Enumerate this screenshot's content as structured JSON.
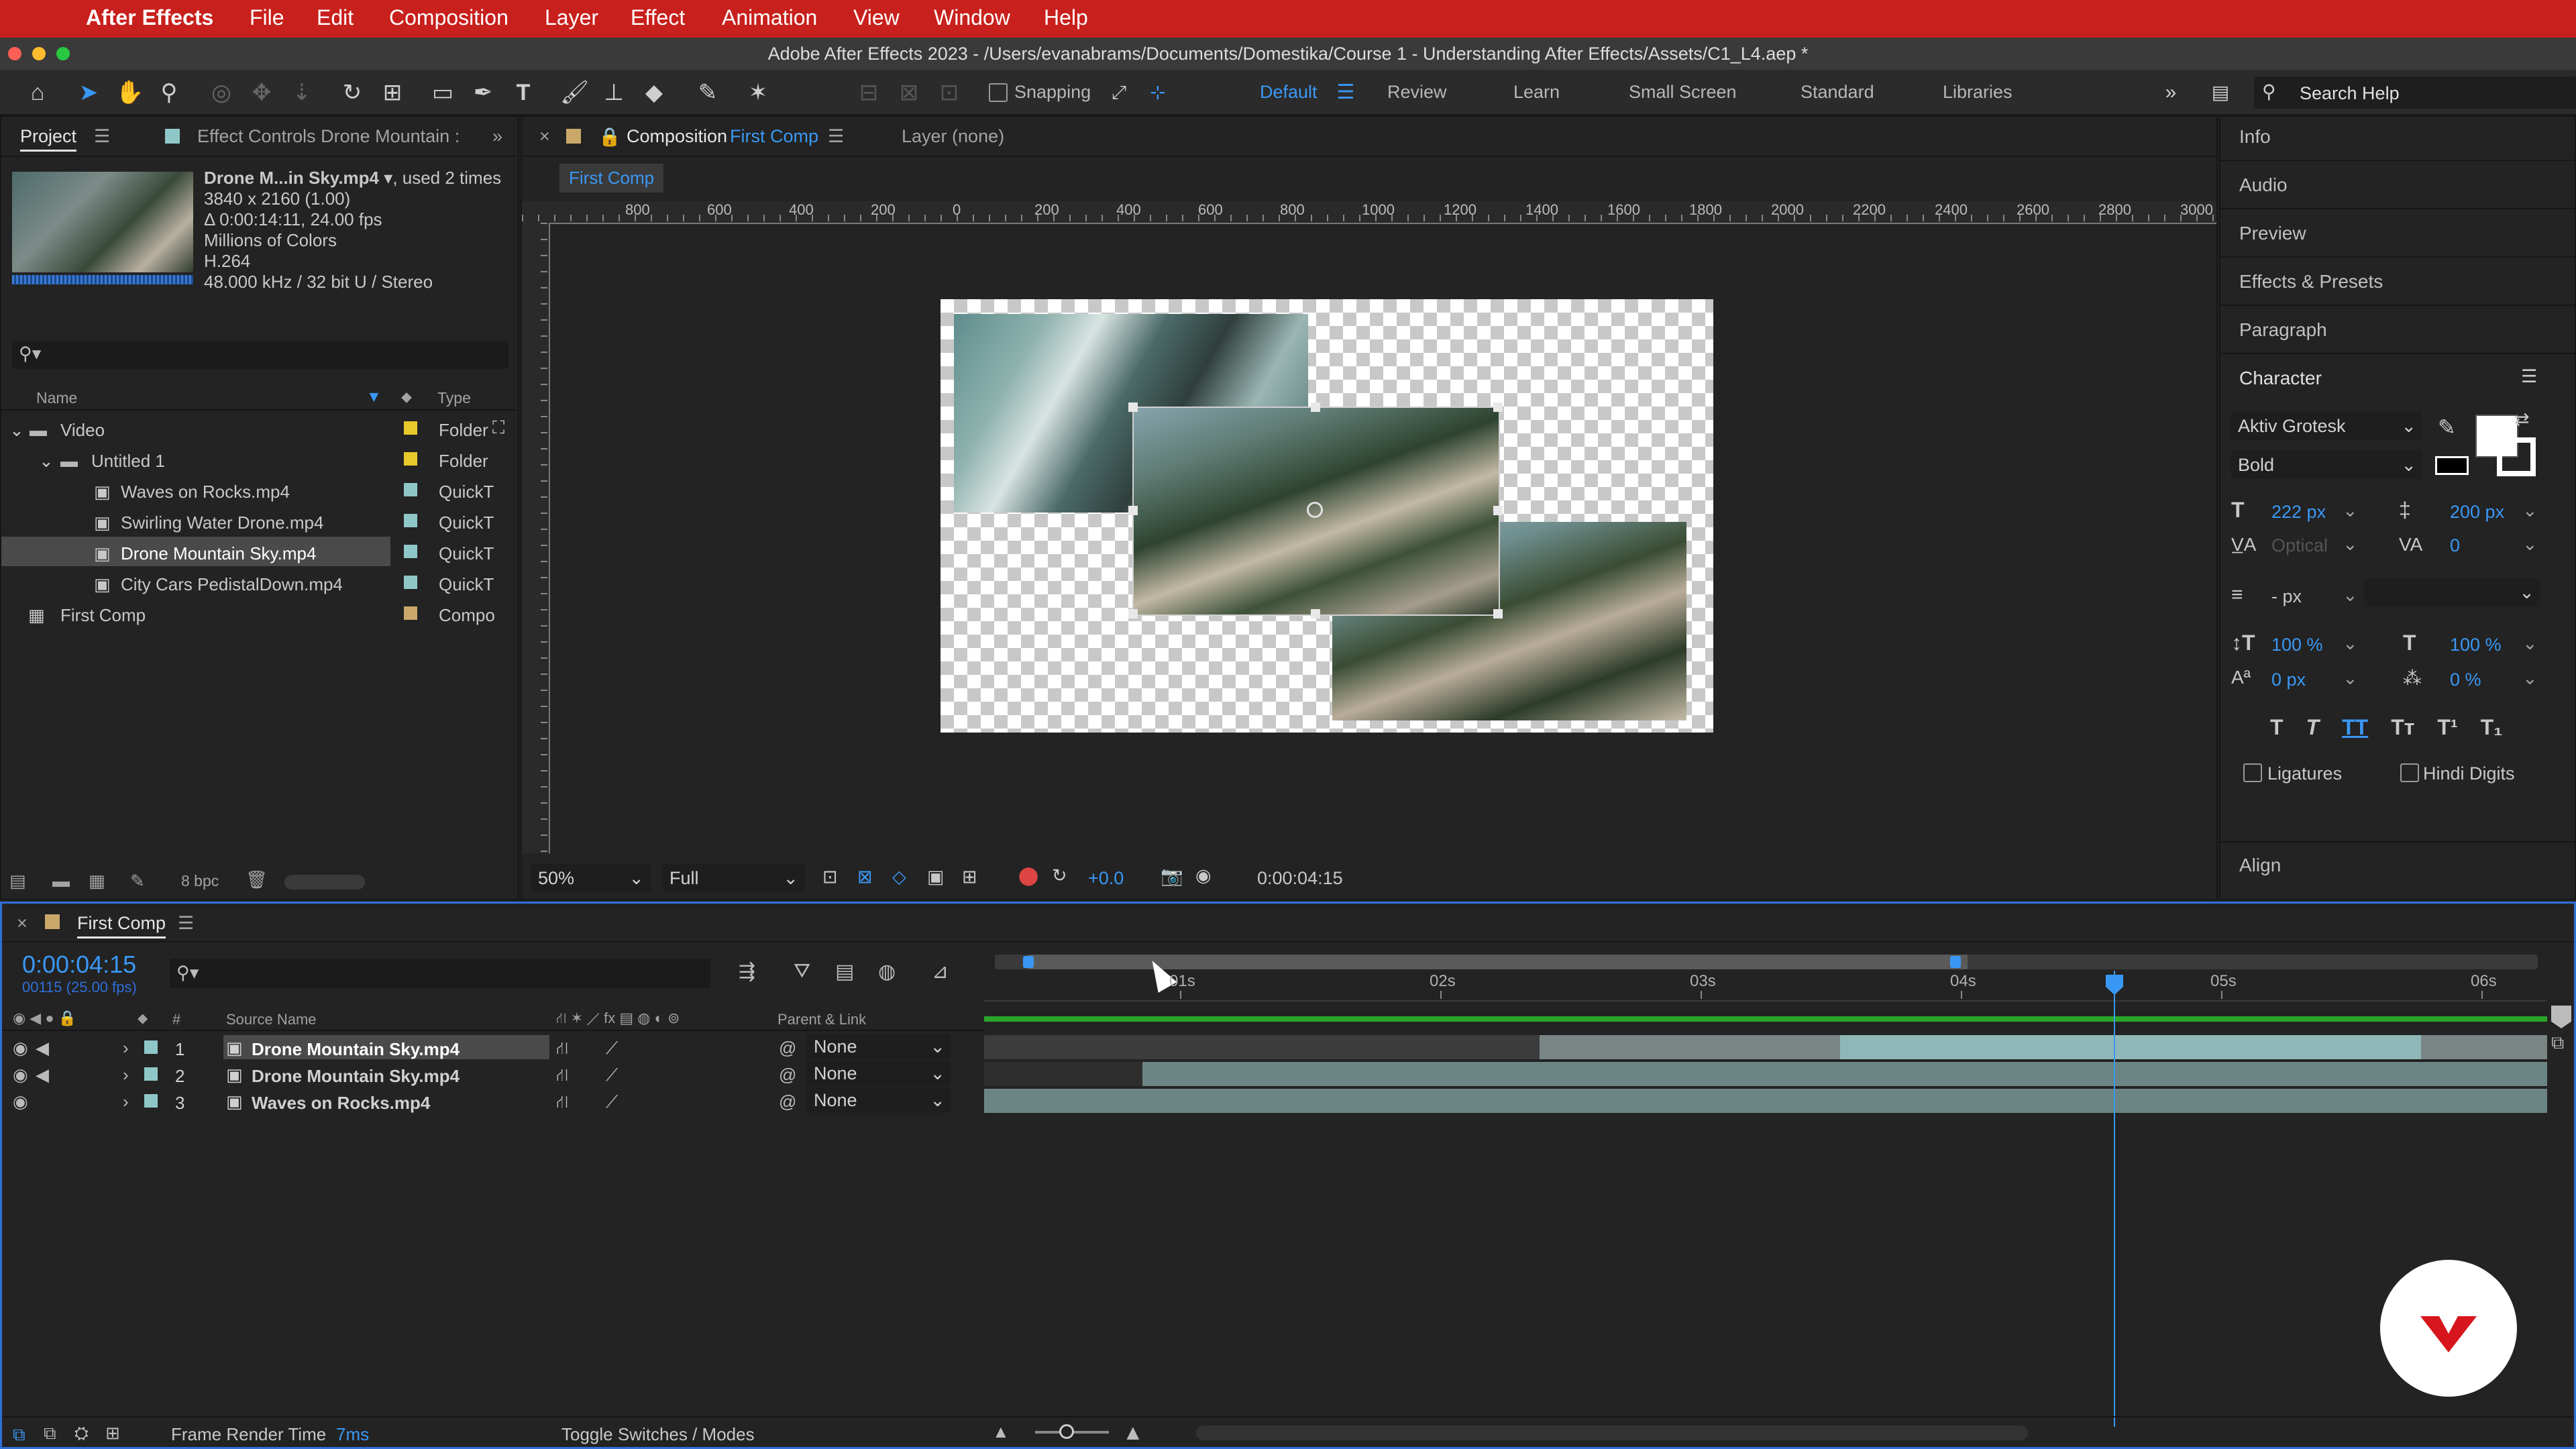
{
  "menubar": {
    "app": "After Effects",
    "items": [
      "File",
      "Edit",
      "Composition",
      "Layer",
      "Effect",
      "Animation",
      "View",
      "Window",
      "Help"
    ]
  },
  "window_title": "Adobe After Effects 2023 - /Users/evanabrams/Documents/Domestika/Course 1 - Understanding After Effects/Assets/C1_L4.aep *",
  "toolbar": {
    "snapping_label": "Snapping",
    "workspaces": [
      "Default",
      "Review",
      "Learn",
      "Small Screen",
      "Standard",
      "Libraries"
    ],
    "active_workspace": "Default",
    "search_placeholder": "Search Help"
  },
  "project_panel": {
    "tab_project": "Project",
    "tab_effect_controls": "Effect Controls Drone Mountain :",
    "selected_item": {
      "name": "Drone M...in Sky.mp4",
      "used": ", used 2 times",
      "resolution": "3840 x 2160 (1.00)",
      "duration": "Δ 0:00:14:11, 24.00 fps",
      "colors": "Millions of Colors",
      "codec": "H.264",
      "audio": "48.000 kHz / 32 bit U / Stereo"
    },
    "columns": {
      "name": "Name",
      "type": "Type"
    },
    "items": [
      {
        "name": "Video",
        "type": "Folder",
        "color": "#e8c92c"
      },
      {
        "name": "Untitled 1",
        "type": "Folder",
        "color": "#e8c92c"
      },
      {
        "name": "Waves on Rocks.mp4",
        "type": "QuickT",
        "color": "#8fc7c8"
      },
      {
        "name": "Swirling Water Drone.mp4",
        "type": "QuickT",
        "color": "#8fc7c8"
      },
      {
        "name": "Drone Mountain Sky.mp4",
        "type": "QuickT",
        "color": "#8fc7c8"
      },
      {
        "name": "City Cars PedistalDown.mp4",
        "type": "QuickT",
        "color": "#8fc7c8"
      },
      {
        "name": "First Comp",
        "type": "Compo",
        "color": "#c9a86a"
      }
    ],
    "bpc": "8 bpc"
  },
  "composition_panel": {
    "tab_prefix": "Composition",
    "tab_name": "First Comp",
    "layer_tab": "Layer (none)",
    "subtab": "First Comp",
    "ruler_labels": [
      "800",
      "600",
      "400",
      "200",
      "0",
      "200",
      "400",
      "600",
      "800",
      "1000",
      "1200",
      "1400",
      "1600",
      "1800",
      "2000",
      "2200",
      "2400",
      "2600",
      "2800",
      "3000"
    ],
    "zoom": "50%",
    "resolution": "Full",
    "exposure": "+0.0",
    "timecode": "0:00:04:15"
  },
  "right_panel": {
    "items": [
      "Info",
      "Audio",
      "Preview",
      "Effects & Presets",
      "Paragraph"
    ],
    "character_title": "Character",
    "font": "Aktiv Grotesk",
    "style": "Bold",
    "font_size": "222 px",
    "leading": "200 px",
    "kerning": "Optical",
    "tracking": "0",
    "stroke_width": "- px",
    "vscale": "100 %",
    "hscale": "100 %",
    "baseline": "0 px",
    "tsume": "0 %",
    "ligatures": "Ligatures",
    "hindi_digits": "Hindi Digits",
    "align": "Align"
  },
  "timeline": {
    "comp_name": "First Comp",
    "timecode": "0:00:04:15",
    "frame_info": "00115 (25.00 fps)",
    "columns": {
      "source": "Source Name",
      "parent": "Parent & Link",
      "num": "#"
    },
    "layers": [
      {
        "num": "1",
        "name": "Drone Mountain Sky.mp4",
        "parent": "None"
      },
      {
        "num": "2",
        "name": "Drone Mountain Sky.mp4",
        "parent": "None"
      },
      {
        "num": "3",
        "name": "Waves on Rocks.mp4",
        "parent": "None"
      }
    ],
    "time_ticks": [
      "01s",
      "02s",
      "03s",
      "04s",
      "05s",
      "06s"
    ],
    "frame_render_label": "Frame Render Time",
    "frame_render_value": "7ms",
    "toggle_label": "Toggle Switches / Modes"
  }
}
